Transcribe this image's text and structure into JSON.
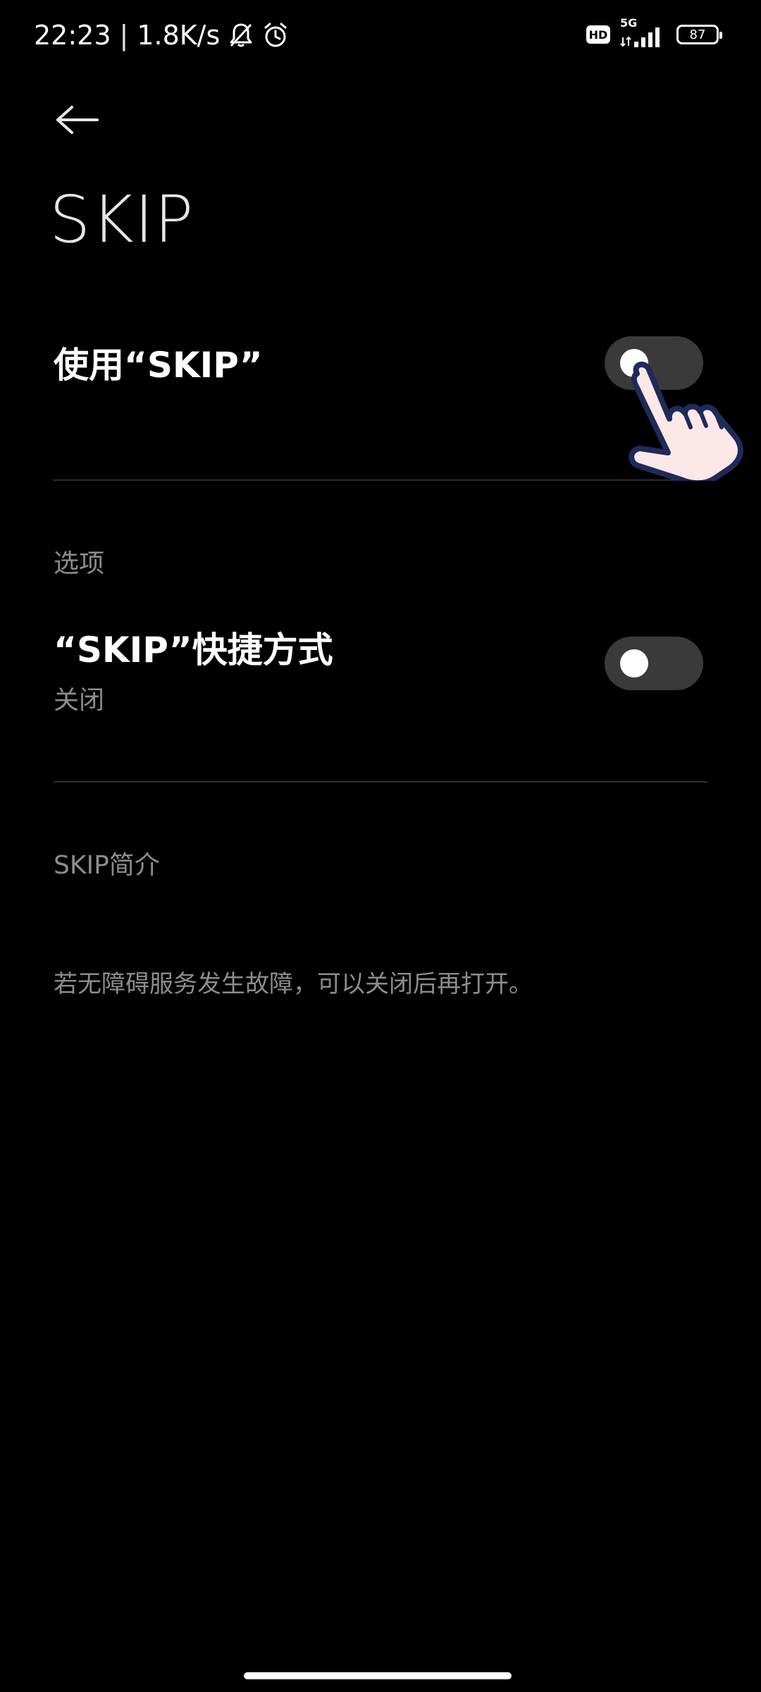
{
  "status_bar": {
    "time": "22:23",
    "separator": "|",
    "net_speed": "1.8K/s",
    "icons": [
      "bell-muted-icon",
      "alarm-icon",
      "hd-icon",
      "signal-5g-icon",
      "battery-icon"
    ],
    "hd_label": "HD",
    "network_type": "5G",
    "battery_level": "87"
  },
  "header": {
    "back_icon": "back-arrow-icon",
    "title": "SKIP"
  },
  "main_toggle": {
    "label": "使用“SKIP”",
    "enabled": false
  },
  "options": {
    "section_label": "选项",
    "shortcut": {
      "label": "“SKIP”快捷方式",
      "status": "关闭",
      "enabled": false
    }
  },
  "intro": {
    "section_label": "SKIP简介",
    "description": "若无障碍服务发生故障，可以关闭后再打开。"
  },
  "colors": {
    "background": "#000000",
    "toggle_off_track": "#3a3a3a",
    "secondary_text": "#8c8c8c",
    "divider": "#2e2e2e",
    "hand_fill": "#fde8e8",
    "hand_outline": "#1f2a5a"
  }
}
